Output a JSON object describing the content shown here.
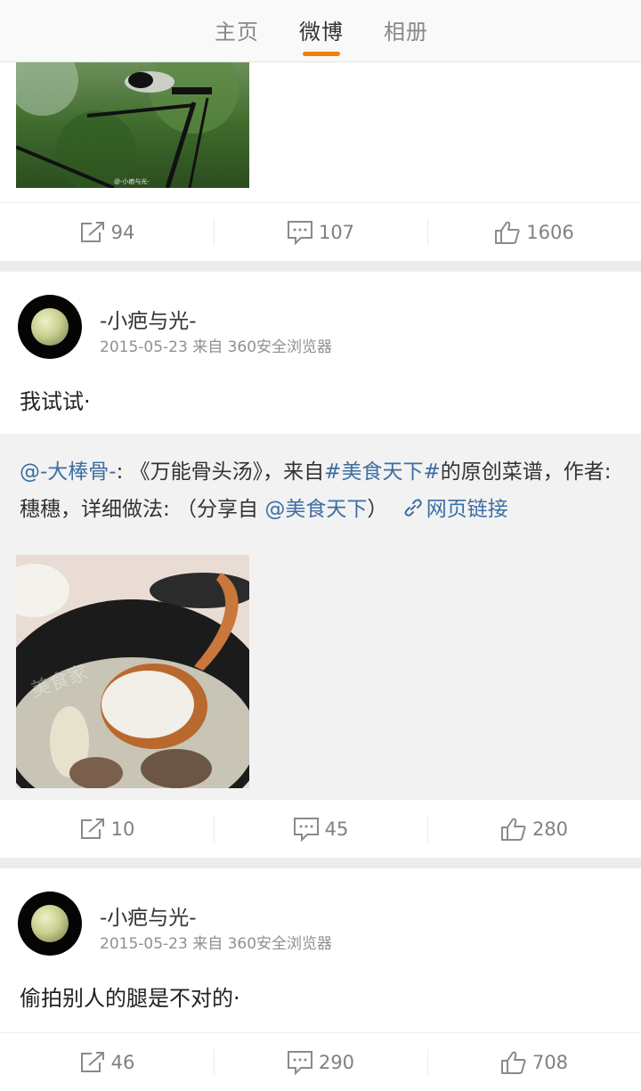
{
  "tabs": [
    {
      "label": "主页",
      "active": false
    },
    {
      "label": "微博",
      "active": true
    },
    {
      "label": "相册",
      "active": false
    }
  ],
  "accent_color": "#f08200",
  "link_color": "#3d6ea2",
  "posts": [
    {
      "image_watermark": "@-小疤与光-",
      "actions": {
        "repost": "94",
        "comment": "107",
        "like": "1606"
      }
    },
    {
      "author": "-小疤与光-",
      "meta": "2015-05-23 来自 360安全浏览器",
      "text": "我试试·",
      "repost": {
        "mention": "@-大棒骨-",
        "part1": ": 《万能骨头汤》，来自",
        "hashtag": "#美食天下#",
        "part2": "的原创菜谱，作者:穗穗，详细做法: （分享自 ",
        "source": "@美食天下",
        "part3": "）",
        "link_label": "网页链接",
        "image_watermark": "美食家"
      },
      "actions": {
        "repost": "10",
        "comment": "45",
        "like": "280"
      }
    },
    {
      "author": "-小疤与光-",
      "meta": "2015-05-23 来自 360安全浏览器",
      "text": "偷拍别人的腿是不对的·",
      "actions": {
        "repost": "46",
        "comment": "290",
        "like": "708"
      }
    }
  ]
}
